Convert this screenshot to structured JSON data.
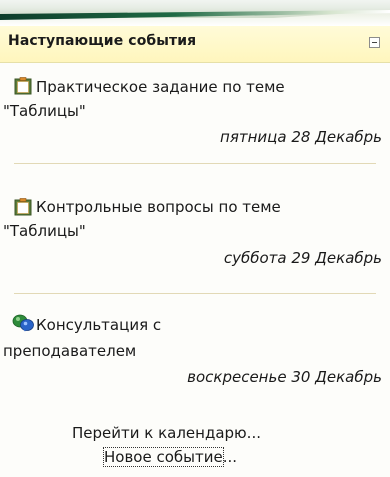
{
  "block": {
    "title": "Наступающие события",
    "collapse_icon": "minus-box-icon"
  },
  "events": [
    {
      "icon": "assignment-clipboard-icon",
      "line1": "Практическое задание по теме",
      "line2": "\"Таблицы\"",
      "date": "пятница 28 Декабрь"
    },
    {
      "icon": "assignment-clipboard-icon",
      "line1": "Контрольные вопросы по теме",
      "line2": "\"Таблицы\"",
      "date": "суббота 29 Декабрь"
    },
    {
      "icon": "chat-consultation-icon",
      "line1": "Консультация с",
      "line2": "преподавателем",
      "date": "воскресенье 30 Декабрь"
    }
  ],
  "footer": {
    "calendar_link": "Перейти к календарю...",
    "new_event_link": "Новое событие",
    "new_event_suffix": "..."
  },
  "colors": {
    "header_bg": "#fff6bd",
    "divider": "#e2d9b6",
    "accent_green": "#1f6a44"
  }
}
